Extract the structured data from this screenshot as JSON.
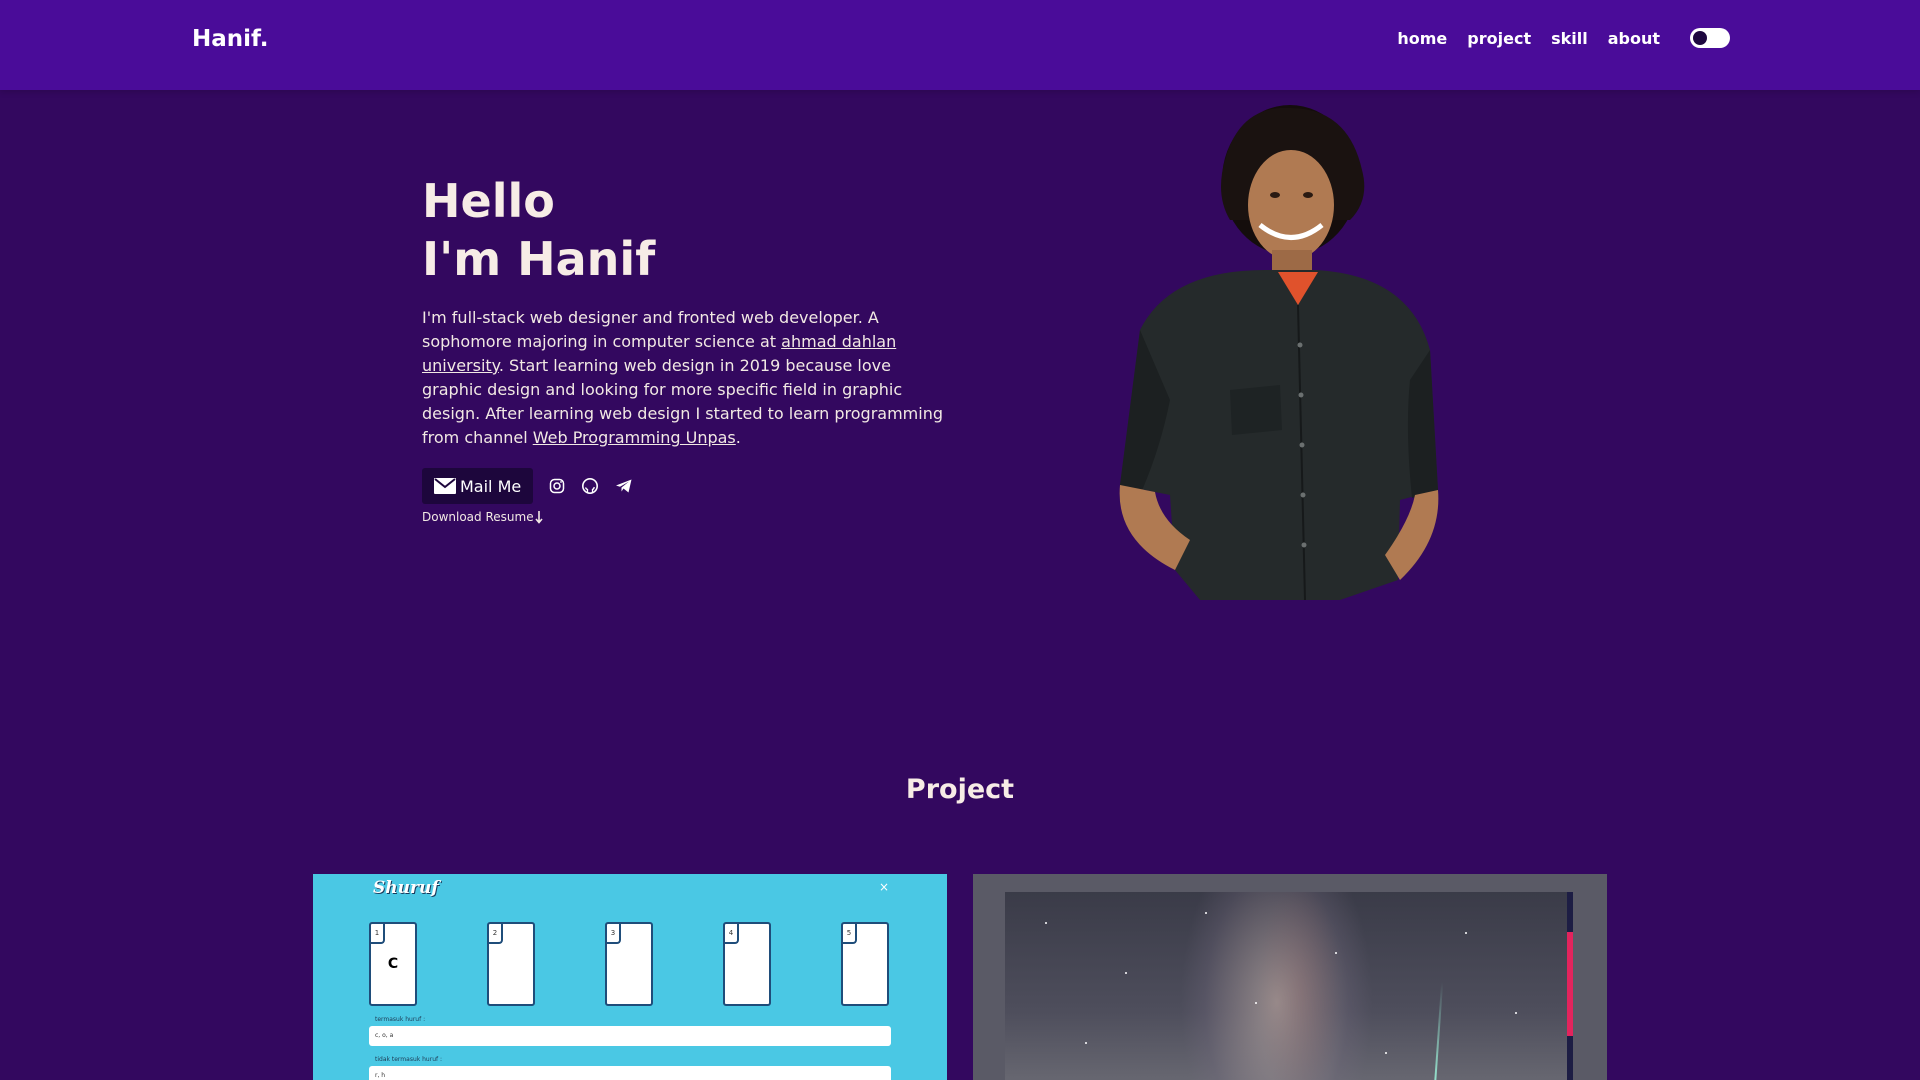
{
  "navbar": {
    "brand": "Hanif.",
    "links": [
      "home",
      "project",
      "skill",
      "about"
    ]
  },
  "hero": {
    "greeting": "Hello",
    "name_line": "I'm Hanif",
    "desc_part1": "I'm full-stack web designer and fronted web developer. A sophomore majoring in computer science at ",
    "link_university": "ahmad dahlan university",
    "desc_part2": ". Start learning web design in 2019 because love graphic design and looking for more specific field in graphic design. After learning web design I started to learn programming from channel ",
    "link_channel": "Web Programming Unpas",
    "desc_part3": ".",
    "mail_button": "Mail Me",
    "social_icons": [
      "instagram-icon",
      "github-icon",
      "telegram-icon"
    ],
    "download": "Download Resume"
  },
  "project": {
    "title": "Project",
    "card1": {
      "app_title": "Shuruf",
      "close": "×",
      "slots": [
        {
          "num": "1",
          "letter": "C"
        },
        {
          "num": "2",
          "letter": ""
        },
        {
          "num": "3",
          "letter": ""
        },
        {
          "num": "4",
          "letter": ""
        },
        {
          "num": "5",
          "letter": ""
        }
      ],
      "field1_label": "termasuk huruf :",
      "field1_value": "c, o, a",
      "field2_label": "tidak termasuk huruf :",
      "field2_value": "r, h"
    }
  },
  "colors": {
    "navbar": "#4a0c99",
    "background": "#33085f",
    "button": "#1d063c",
    "card1": "#4ac8e4"
  }
}
